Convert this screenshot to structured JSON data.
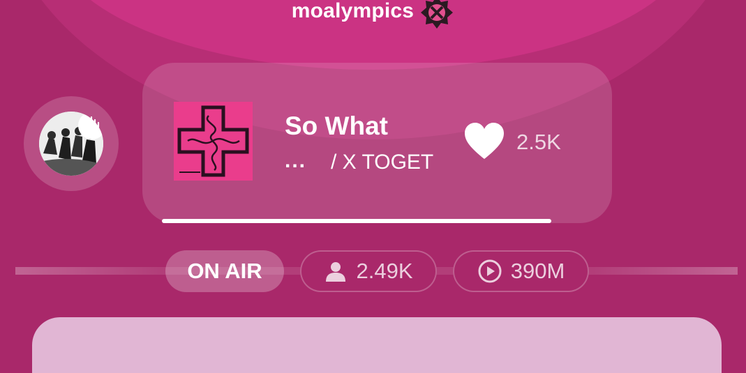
{
  "host": {
    "name": "moalympics",
    "badge_icon": "txt-logo-badge-icon"
  },
  "now_playing": {
    "title": "So What",
    "artist_dots": "...",
    "artist": "/ X TOGET",
    "likes": "2.5K",
    "progress": 1.0
  },
  "stats": {
    "on_air_label": "ON AIR",
    "listeners": "2.49K",
    "plays": "390M"
  },
  "colors": {
    "background": "#a9286a",
    "halo": "#cb3383",
    "album": "#ea3d8c",
    "panel": "#e1b6d4"
  }
}
